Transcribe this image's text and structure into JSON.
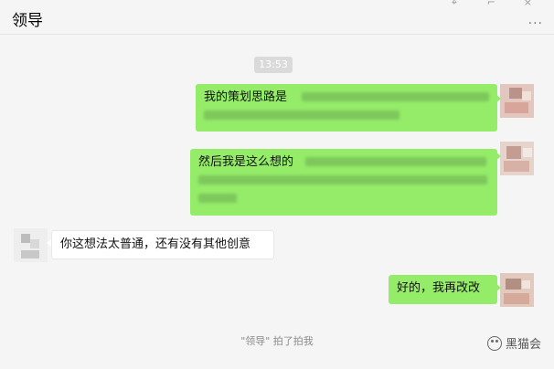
{
  "header": {
    "title": "领导",
    "more_label": "..."
  },
  "timestamp": "13:53",
  "messages": [
    {
      "side": "right",
      "text": "我的策划思路是"
    },
    {
      "side": "right",
      "text": "然后我是这么想的"
    },
    {
      "side": "left",
      "text": "你这想法太普通，还有没有其他创意"
    },
    {
      "side": "right",
      "text": "好的，我再改改"
    }
  ],
  "system_notice": "\"领导\" 拍了拍我",
  "watermark": "黑猫会",
  "colors": {
    "my_bubble": "#95ec69",
    "other_bubble": "#ffffff",
    "background": "#f5f5f5"
  }
}
